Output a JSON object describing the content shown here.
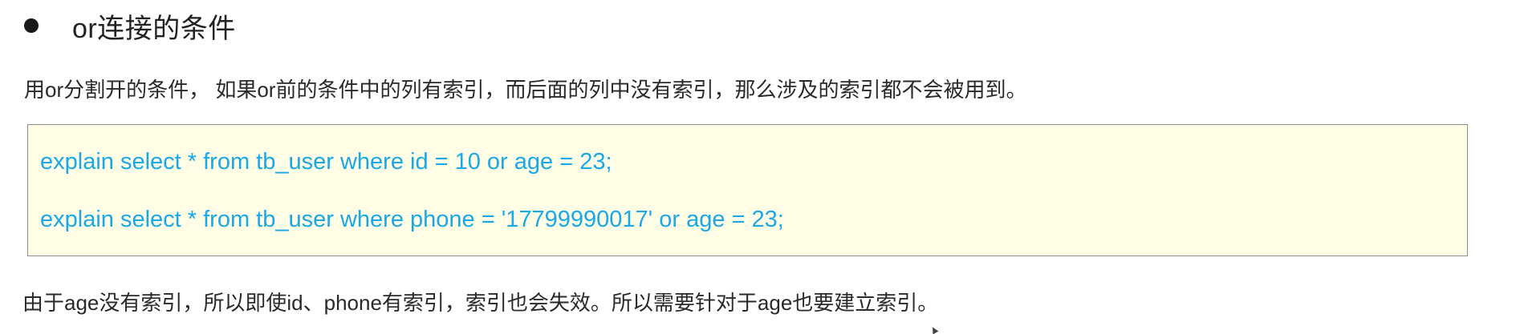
{
  "heading": {
    "bullet_icon": "bullet-dot-icon",
    "text": "or连接的条件"
  },
  "intro_text": "用or分割开的条件， 如果or前的条件中的列有索引，而后面的列中没有索引，那么涉及的索引都不会被用到。",
  "code_block": {
    "background_color": "#fffde6",
    "text_color": "#19a8ea",
    "lines": [
      "explain select * from tb_user where id = 10 or age = 23;",
      "explain select * from tb_user where phone = '17799990017' or age = 23;"
    ]
  },
  "conclusion_text": "由于age没有索引，所以即使id、phone有索引，索引也会失效。所以需要针对于age也要建立索引。",
  "cursor_icon": "mouse-pointer-icon"
}
